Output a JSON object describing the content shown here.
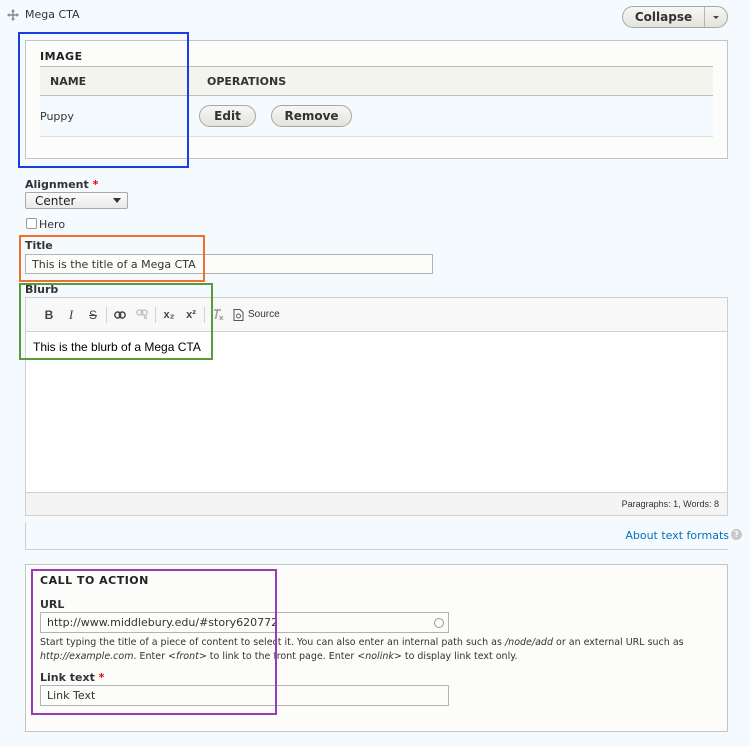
{
  "paragraph": {
    "title": "Mega CTA",
    "collapse_label": "Collapse"
  },
  "image": {
    "legend": "IMAGE",
    "columns": [
      "NAME",
      "OPERATIONS"
    ],
    "rows": [
      {
        "name": "Puppy",
        "edit_label": "Edit",
        "remove_label": "Remove"
      }
    ]
  },
  "alignment": {
    "label": "Alignment",
    "required_mark": "*",
    "value": "Center"
  },
  "hero": {
    "label": "Hero",
    "checked": false
  },
  "title_field": {
    "label": "Title",
    "value": "This is the title of a Mega CTA"
  },
  "blurb": {
    "label": "Blurb",
    "toolbar": {
      "bold": "B",
      "italic": "I",
      "strike": "S",
      "subscript": "x₂",
      "superscript": "x²",
      "source_label": "Source"
    },
    "content": "This is the blurb of a Mega CTA",
    "status": "Paragraphs: 1, Words: 8",
    "formats_link": "About text formats",
    "help_glyph": "?"
  },
  "cta": {
    "legend": "CALL TO ACTION",
    "url_label": "URL",
    "url_value": "http://www.middlebury.edu/#story620772",
    "desc": {
      "p1": "Start typing the title of a piece of content to select it. You can also enter an internal path such as ",
      "node_add": "/node/add",
      "p2": " or an external URL such as ",
      "example": "http://example.com",
      "p3": ". Enter ",
      "front": "<front>",
      "p4": " to link to the front page. Enter ",
      "nolink": "<nolink>",
      "p5": " to display link text only."
    },
    "link_text_label": "Link text",
    "required_mark": "*",
    "link_text_value": "Link Text"
  },
  "annotations": {
    "blue": "#1a3fe0",
    "orange": "#f07030",
    "green": "#5a9a3a",
    "purple": "#9a3ab8"
  }
}
